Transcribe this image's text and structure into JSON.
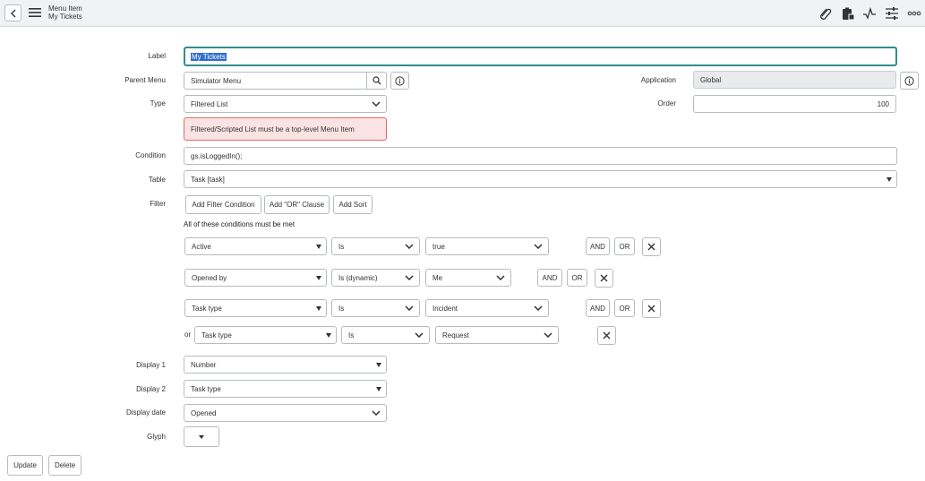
{
  "header": {
    "record_type": "Menu Item",
    "record_name": "My Tickets",
    "icons": [
      "back-icon",
      "hamburger-menu-icon",
      "attachment-icon",
      "clipboard-icon",
      "activity-icon",
      "settings-sliders-icon",
      "more-icon"
    ]
  },
  "form": {
    "label": {
      "label": "Label",
      "value": "My Tickets"
    },
    "parent_menu": {
      "label": "Parent Menu",
      "value": "Simulator Menu"
    },
    "application": {
      "label": "Application",
      "value": "Global"
    },
    "type": {
      "label": "Type",
      "value": "Filtered List"
    },
    "order": {
      "label": "Order",
      "value": "100"
    },
    "error_message": "Filtered/Scripted List must be a top-level Menu Item",
    "condition": {
      "label": "Condition",
      "value": "gs.isLoggedIn();"
    },
    "table": {
      "label": "Table",
      "value": "Task [task]"
    },
    "filter": {
      "label": "Filter",
      "buttons": {
        "add_condition": "Add Filter Condition",
        "add_or": "Add \"OR\" Clause",
        "add_sort": "Add Sort"
      },
      "heading": "All of these conditions must be met",
      "rows": [
        {
          "field": "Active",
          "operator": "Is",
          "value": "true"
        },
        {
          "field": "Opened by",
          "operator": "Is (dynamic)",
          "value": "Me"
        },
        {
          "field": "Task type",
          "operator": "Is",
          "value": "Incident"
        },
        {
          "prefix": "or",
          "field": "Task type",
          "operator": "Is",
          "value": "Request"
        }
      ],
      "and_label": "AND",
      "or_label": "OR"
    },
    "display1": {
      "label": "Display 1",
      "value": "Number"
    },
    "display2": {
      "label": "Display 2",
      "value": "Task type"
    },
    "display_date": {
      "label": "Display date",
      "value": "Opened"
    },
    "glyph": {
      "label": "Glyph"
    }
  },
  "actions": {
    "update": "Update",
    "delete": "Delete"
  },
  "colors": {
    "focus_border": "#2f8f87",
    "error_bg": "#fce3e3",
    "error_border": "#e06a6a",
    "selection": "#2f6fcf"
  }
}
